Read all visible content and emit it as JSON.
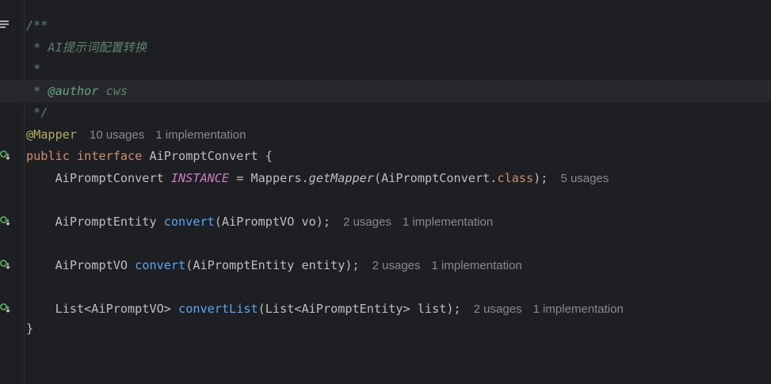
{
  "editor": {
    "comment": {
      "open": "/**",
      "title": " * AI提示词配置转换",
      "blank": " *",
      "author_prefix": " * ",
      "author_tag": "@author",
      "author_name": "cws",
      "close": " */"
    },
    "annotation": "@Mapper",
    "annotation_hints": {
      "usages": "10 usages",
      "impl": "1 implementation"
    },
    "decl": {
      "kw1": "public",
      "kw2": "interface",
      "name": "AiPromptConvert",
      "brace": "{"
    },
    "line_instance": {
      "type": "AiPromptConvert",
      "field": "INSTANCE",
      "eq": "=",
      "call_obj": "Mappers.",
      "call_method": "getMapper",
      "arg_open": "(AiPromptConvert.",
      "arg_kw": "class",
      "arg_close": ");",
      "usages": "5 usages"
    },
    "method1": {
      "ret": "AiPromptEntity",
      "name": "convert",
      "params": "(AiPromptVO vo);",
      "usages": "2 usages",
      "impl": "1 implementation"
    },
    "method2": {
      "ret": "AiPromptVO",
      "name": "convert",
      "params": "(AiPromptEntity entity);",
      "usages": "2 usages",
      "impl": "1 implementation"
    },
    "method3": {
      "ret": "List<AiPromptVO>",
      "name": "convertList",
      "params": "(List<AiPromptEntity> list);",
      "usages": "2 usages",
      "impl": "1 implementation"
    },
    "close_brace": "}"
  },
  "gutter": {
    "fold_icon": "fold-lines-icon",
    "impl_icon": "implemented-down-arrow-icon",
    "accent_color": "#5fb865"
  }
}
